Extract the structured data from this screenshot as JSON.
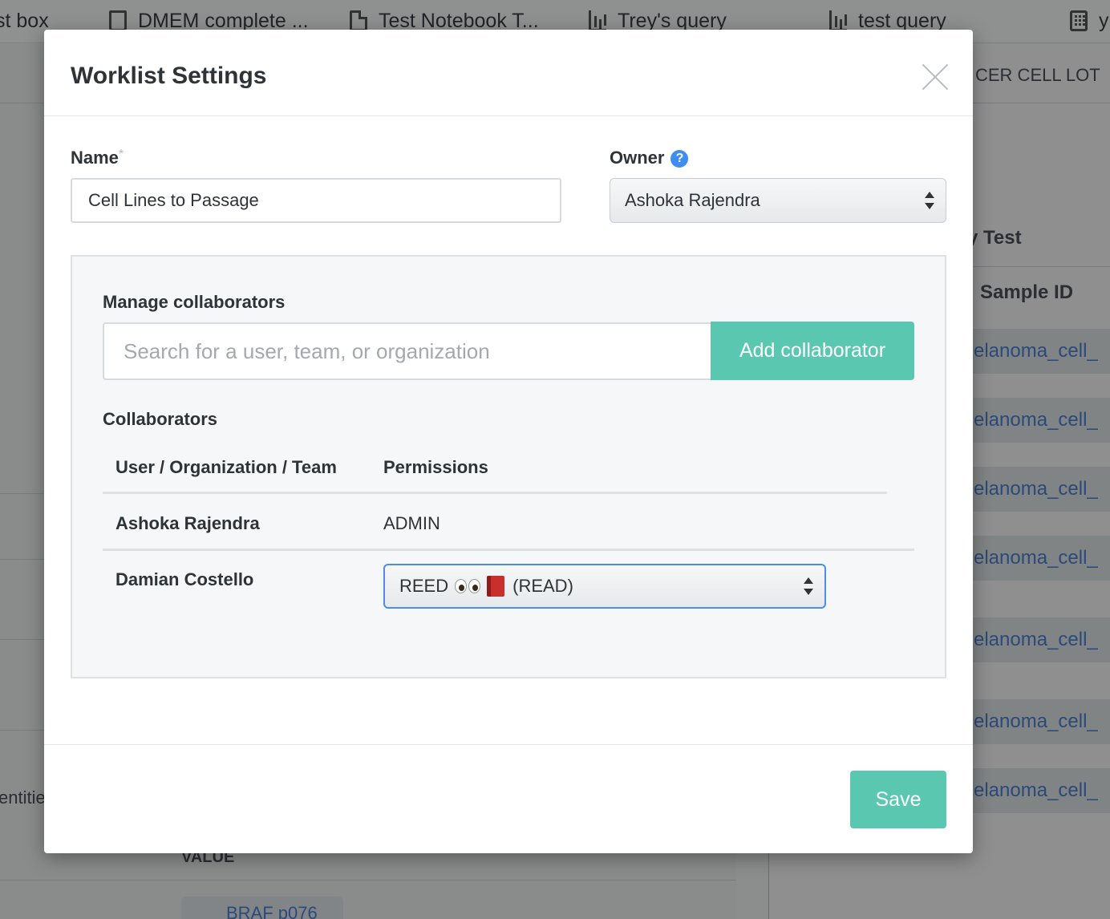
{
  "background": {
    "tabs": [
      {
        "label": "st box",
        "icon": "none"
      },
      {
        "label": "DMEM complete ...",
        "icon": "flask-icon"
      },
      {
        "label": "Test Notebook T...",
        "icon": "document-icon"
      },
      {
        "label": "Trey's query",
        "icon": "bar-chart-icon"
      },
      {
        "label": "test query",
        "icon": "bar-chart-icon"
      },
      {
        "label": "y",
        "icon": "grid-icon"
      }
    ],
    "right_header": "CER CELL LOT",
    "right_title": "y Test",
    "right_column": "Sample ID",
    "sample_links": [
      "elanoma_cell_",
      "elanoma_cell_",
      "elanoma_cell_",
      "elanoma_cell_",
      "elanoma_cell_",
      "elanoma_cell_",
      "elanoma_cell_"
    ],
    "left_fragment": "entitie",
    "value_header": "VALUE",
    "chip_text": "BRAF p076"
  },
  "modal": {
    "title": "Worklist Settings",
    "name_label": "Name",
    "required_mark": "*",
    "name_value": "Cell Lines to Passage",
    "owner_label": "Owner",
    "owner_help": "?",
    "owner_value": "Ashoka Rajendra",
    "manage_label": "Manage collaborators",
    "search_placeholder": "Search for a user, team, or organization",
    "add_button": "Add collaborator",
    "collaborators_label": "Collaborators",
    "columns": [
      "User / Organization / Team",
      "Permissions"
    ],
    "rows": [
      {
        "user": "Ashoka Rajendra",
        "permission": "ADMIN"
      },
      {
        "user": "Damian Costello",
        "permission_prefix": "REED",
        "permission_suffix": "(READ)"
      }
    ],
    "save_button": "Save"
  },
  "colors": {
    "accent": "#5ac8b1",
    "focus": "#4b8de8",
    "help": "#3f8df0",
    "link": "#4a7fd0"
  }
}
